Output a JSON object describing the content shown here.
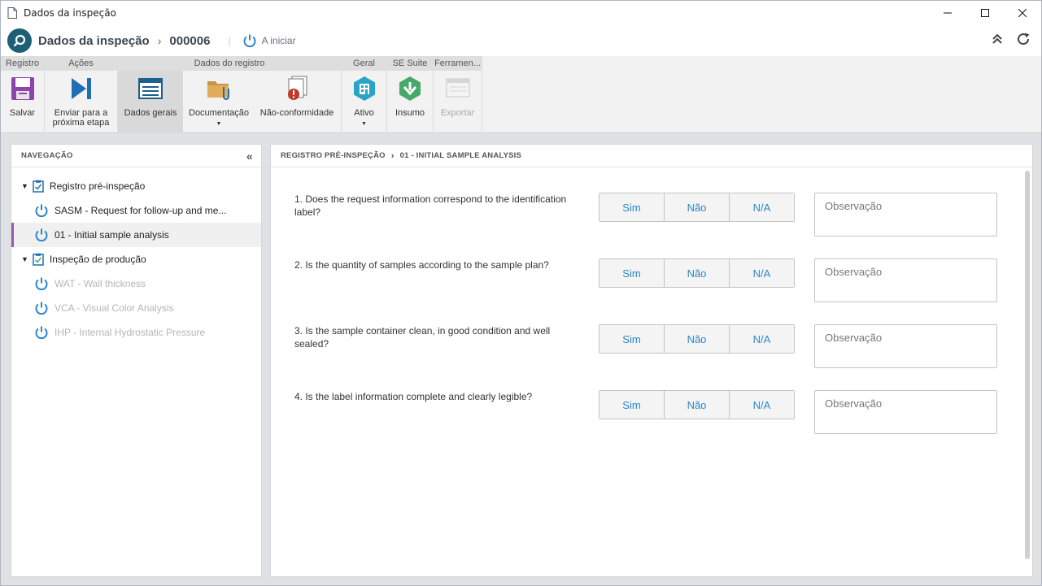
{
  "window": {
    "title": "Dados da inspeção"
  },
  "header": {
    "title": "Dados da inspeção",
    "record_number": "000006",
    "separator": "|",
    "status": "A iniciar"
  },
  "ribbon": {
    "groups": [
      {
        "label": "Registro",
        "buttons": [
          {
            "label": "Salvar",
            "icon": "save-icon"
          }
        ]
      },
      {
        "label": "Ações",
        "buttons": [
          {
            "label": "Enviar para a próxima etapa",
            "icon": "send-next-icon"
          }
        ]
      },
      {
        "label": "Dados do registro",
        "buttons": [
          {
            "label": "Dados gerais",
            "icon": "general-data-icon"
          },
          {
            "label": "Documentação",
            "icon": "documentation-icon"
          },
          {
            "label": "Não-conformidade",
            "icon": "nonconformity-icon"
          }
        ]
      },
      {
        "label": "Geral",
        "buttons": [
          {
            "label": "Ativo",
            "icon": "asset-icon"
          }
        ]
      },
      {
        "label": "SE Suite",
        "buttons": [
          {
            "label": "Insumo",
            "icon": "input-icon"
          }
        ]
      },
      {
        "label": "Ferramen...",
        "buttons": [
          {
            "label": "Exportar",
            "icon": "export-icon"
          }
        ]
      }
    ]
  },
  "nav": {
    "title": "NAVEGAÇÃO",
    "groups": [
      {
        "label": "Registro pré-inspeção",
        "items": [
          {
            "label": "SASM - Request for follow-up and me..."
          },
          {
            "label": "01 - Initial sample analysis"
          }
        ]
      },
      {
        "label": "Inspeção de produção",
        "items": [
          {
            "label": "WAT - Wall thickness"
          },
          {
            "label": "VCA - Visual Color Analysis"
          },
          {
            "label": "IHP - Internal Hydrostatic Pressure"
          }
        ]
      }
    ]
  },
  "main": {
    "breadcrumb": [
      "REGISTRO PRÉ-INSPEÇÃO",
      "01 - INITIAL SAMPLE ANALYSIS"
    ],
    "options": [
      "Sim",
      "Não",
      "N/A"
    ],
    "observation_placeholder": "Observação",
    "questions": [
      "1. Does the request information correspond to the identification label?",
      "2. Is the quantity of samples according to the sample plan?",
      "3. Is the sample container clean, in good condition and well sealed?",
      "4. Is the label information complete and clearly legible?"
    ]
  },
  "colors": {
    "accent_blue": "#2b87c8",
    "selection_bar": "#9b59b6",
    "logo": "#1d5f75"
  }
}
